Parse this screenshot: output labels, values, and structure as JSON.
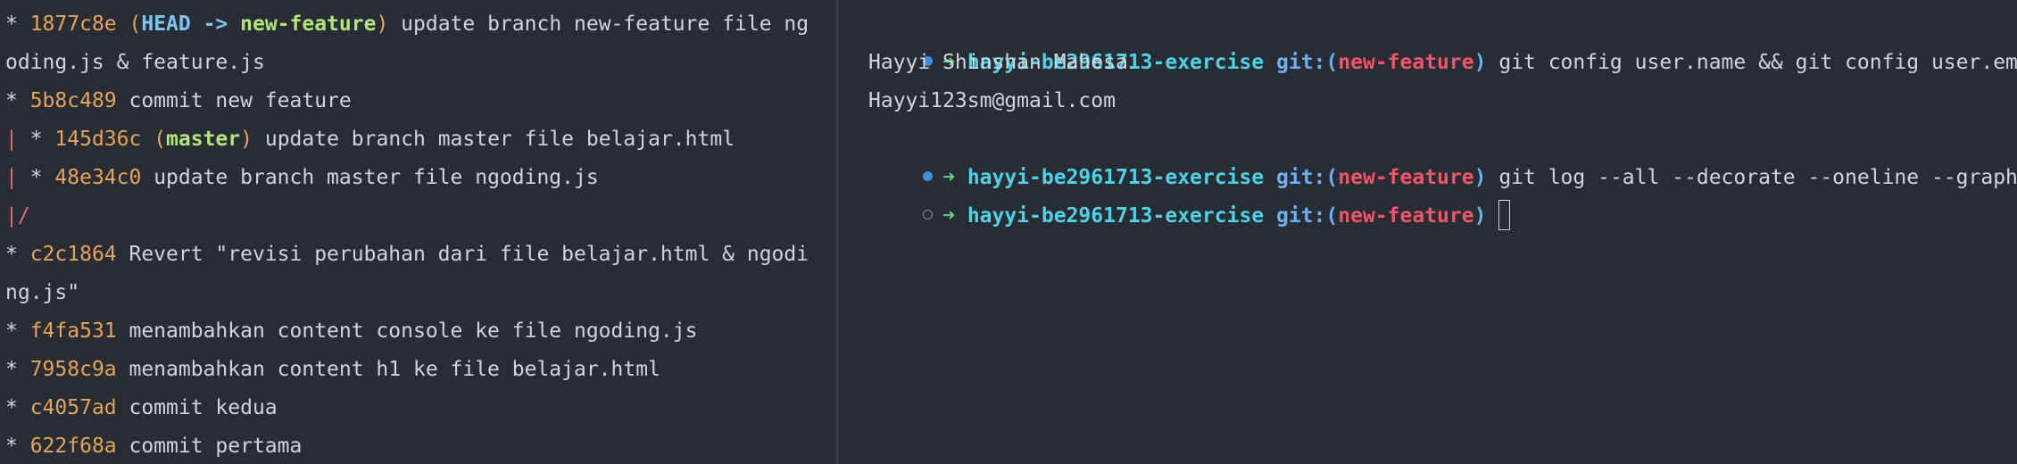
{
  "left": {
    "lines": [
      {
        "graph": "* ",
        "hash": "1877c8e",
        "refs_open": " (",
        "head": "HEAD -> ",
        "branch": "new-feature",
        "refs_close": ")",
        "msg": " update branch new-feature file ng"
      },
      {
        "cont": "oding.js & feature.js"
      },
      {
        "graph": "* ",
        "hash": "5b8c489",
        "msg": " commit new feature"
      },
      {
        "graph_bar": "|",
        "graph": " * ",
        "hash": "145d36c",
        "refs_open": " (",
        "branch": "master",
        "refs_close": ")",
        "msg": " update branch master file belajar.html"
      },
      {
        "graph_bar": "|",
        "graph": " * ",
        "hash": "48e34c0",
        "msg": " update branch master file ngoding.js"
      },
      {
        "graph_bar": "|/"
      },
      {
        "graph": "* ",
        "hash": "c2c1864",
        "msg": " Revert \"revisi perubahan dari file belajar.html & ngodi"
      },
      {
        "cont": "ng.js\""
      },
      {
        "graph": "* ",
        "hash": "f4fa531",
        "msg": " menambahkan content console ke file ngoding.js"
      },
      {
        "graph": "* ",
        "hash": "7958c9a",
        "msg": " menambahkan content h1 ke file belajar.html"
      },
      {
        "graph": "* ",
        "hash": "c4057ad",
        "msg": " commit kedua"
      },
      {
        "graph": "* ",
        "hash": "622f68a",
        "msg": " commit pertama"
      }
    ]
  },
  "right": {
    "prompt": {
      "arrow": "➜",
      "dir": "hayyi-be2961713-exercise",
      "git_label": "git:(",
      "branch": "new-feature",
      "git_close": ")"
    },
    "cmd1": "git config user.name && git config user.email",
    "out1": "Hayyi Shinshan Mahesa",
    "out2": "Hayyi123sm@gmail.com",
    "cmd2": "git log --all --decorate --oneline --graph",
    "cmd3": ""
  },
  "colors": {
    "background": "#282c34",
    "hash": "#e5a45a",
    "branch_green": "#b3e57a",
    "head_blue": "#7fc3f0",
    "dir_cyan": "#4dd2e6",
    "git_branch_red": "#f0556a",
    "arrow_green": "#5fd47a"
  }
}
